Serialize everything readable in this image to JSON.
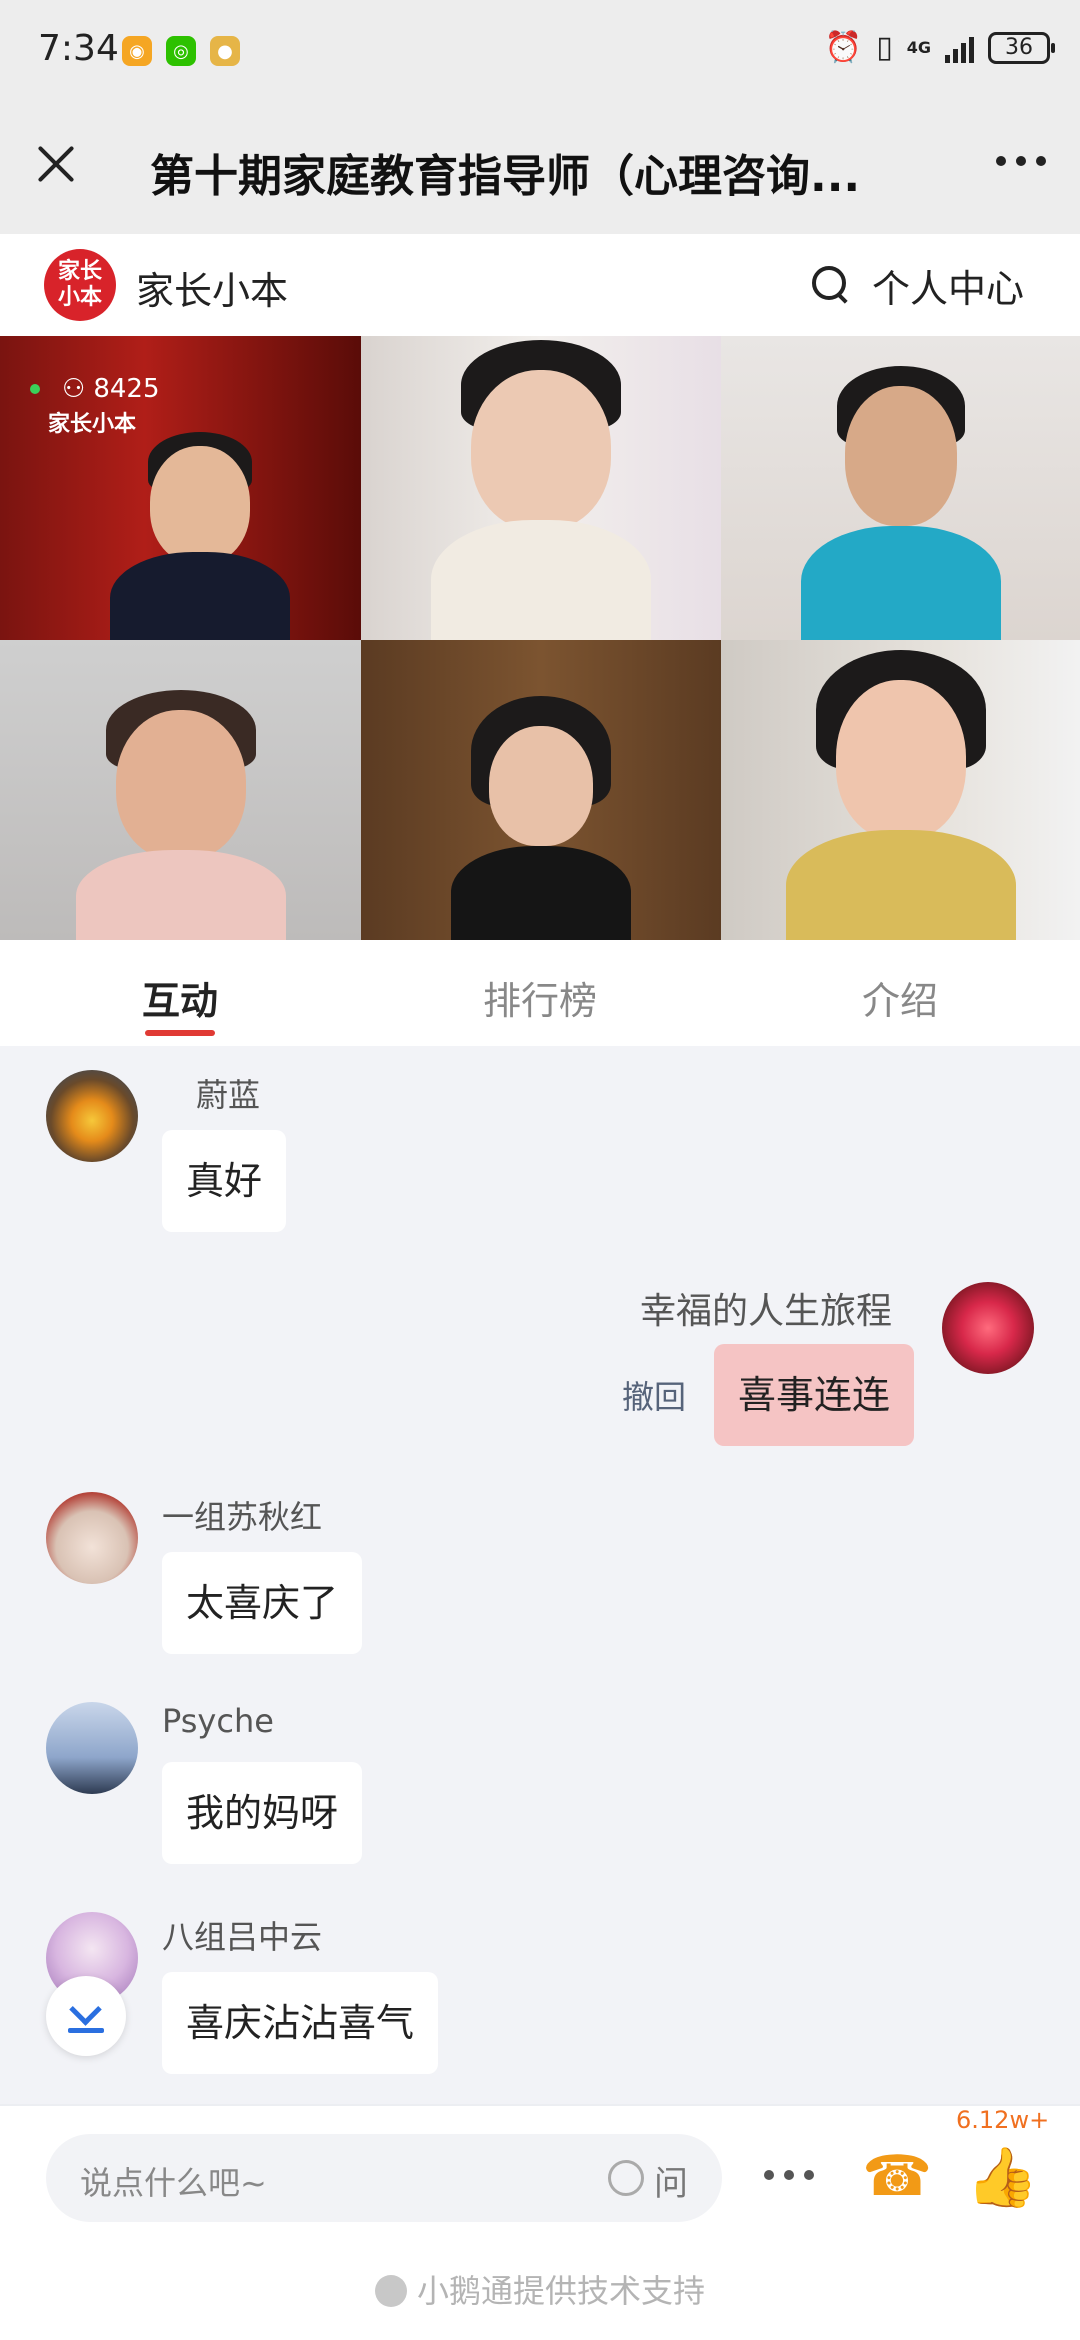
{
  "status": {
    "time": "7:34",
    "battery": "36",
    "network": "4G"
  },
  "titlebar": {
    "title": "第十期家庭教育指导师（心理咨询..."
  },
  "header": {
    "brand": "家长小本",
    "logo_text_1": "家长",
    "logo_text_2": "小本",
    "personal_center": "个人中心"
  },
  "video": {
    "viewer_count": "8425",
    "watermark": "家长小本"
  },
  "tabs": [
    {
      "label": "互动",
      "active": true
    },
    {
      "label": "排行榜",
      "active": false
    },
    {
      "label": "介绍",
      "active": false
    }
  ],
  "messages": [
    {
      "user": "蔚蓝",
      "text": "真好",
      "side": "left"
    },
    {
      "user": "幸福的人生旅程",
      "text": "喜事连连",
      "side": "right",
      "recall": "撤回"
    },
    {
      "user": "一组苏秋红",
      "text": "太喜庆了",
      "side": "left"
    },
    {
      "user": "Psyche",
      "text": "我的妈呀",
      "side": "left"
    },
    {
      "user": "八组吕中云",
      "text": "喜庆沾沾喜气",
      "side": "left"
    }
  ],
  "bottom": {
    "input_placeholder": "说点什么吧~",
    "ask_label": "问",
    "like_count": "6.12w+",
    "footer": "小鹅通提供技术支持"
  },
  "colors": {
    "accent": "#e03a34",
    "self_bubble": "#f5c4c4",
    "phone": "#f29a16",
    "like": "#f47aa6"
  }
}
